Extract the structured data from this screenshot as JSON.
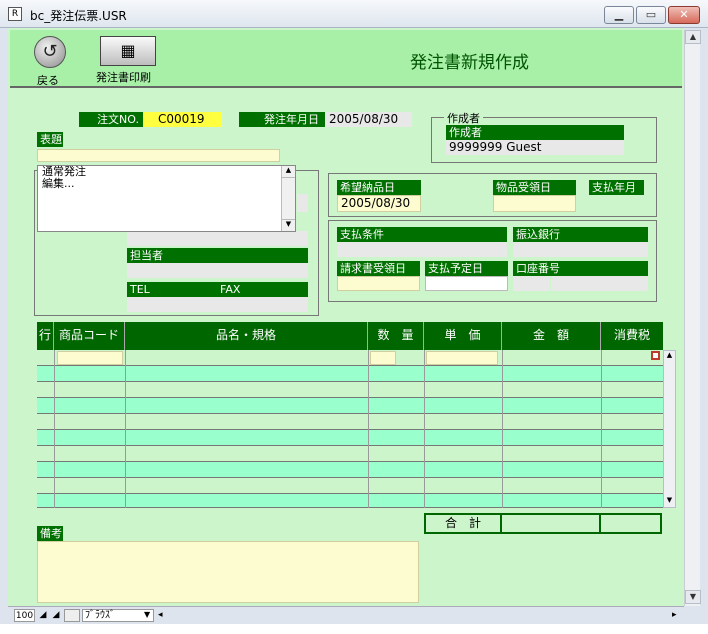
{
  "window": {
    "title": "bc_発注伝票.USR",
    "min_glyph": "▁",
    "max_glyph": "▭",
    "close_glyph": "✕"
  },
  "toolbar": {
    "back_label": "戻る",
    "back_glyph": "↺",
    "print_label": "発注書印刷",
    "print_glyph": "▦"
  },
  "page_title": "発注書新規作成",
  "order": {
    "no_label": "注文NO.",
    "no_value": "C00019",
    "date_label": "発注年月日",
    "date_value": "2005/08/30"
  },
  "creator": {
    "group_label": "作成者",
    "field_label": "作成者",
    "value": "9999999 Guest"
  },
  "subject": {
    "label": "表題",
    "value": ""
  },
  "list": {
    "items": [
      "通常発注",
      "編集..."
    ]
  },
  "contact": {
    "person_label": "担当者",
    "tel_label": "TEL",
    "fax_label": "FAX"
  },
  "dates": {
    "delivery_label": "希望納品日",
    "delivery_value": "2005/08/30",
    "receipt_label": "物品受領日",
    "paymonth_label": "支払年月"
  },
  "payment": {
    "terms_label": "支払条件",
    "bank_label": "振込銀行",
    "invoice_label": "請求書受領日",
    "due_label": "支払予定日",
    "account_label": "口座番号"
  },
  "table": {
    "headers": [
      "行",
      "商品コード",
      "品名・規格",
      "数　量",
      "単　価",
      "金　額",
      "消費税"
    ],
    "total_label": "合　計"
  },
  "notes": {
    "label": "備考"
  },
  "statusbar": {
    "zoom": "100",
    "mode": "ﾌﾞﾗｳｽﾞ"
  },
  "colors": {
    "background": "#ccf5cc",
    "header": "#a8f0a8",
    "label": "#007000",
    "title": "#005500"
  }
}
